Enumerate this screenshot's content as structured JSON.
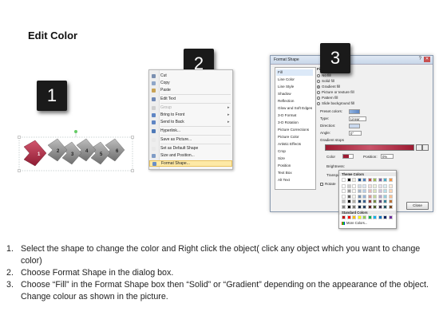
{
  "title": "Edit Color",
  "badges": [
    "1",
    "2",
    "3"
  ],
  "shape_labels": [
    "1",
    "2",
    "3",
    "4",
    "5",
    "6"
  ],
  "colors": {
    "highlight": "#b02a45",
    "shape_gray": "#8c8c8c",
    "menu_highlight": "#fde9a6",
    "gradient_red": "#9e1b32"
  },
  "context_menu": {
    "items": [
      {
        "label": "Cut",
        "icon": "scissors-icon"
      },
      {
        "label": "Copy",
        "icon": "copy-icon"
      },
      {
        "label": "Paste",
        "icon": "paste-icon"
      },
      {
        "label": "Edit Text",
        "icon": "edit-text-icon"
      },
      {
        "label": "Group",
        "icon": "group-icon"
      },
      {
        "label": "Bring to Front",
        "icon": "bring-to-front-icon"
      },
      {
        "label": "Send to Back",
        "icon": "send-to-back-icon"
      },
      {
        "label": "Hyperlink...",
        "icon": "hyperlink-icon"
      },
      {
        "label": "Save as Picture...",
        "icon": "save-picture-icon"
      },
      {
        "label": "Set as Default Shape",
        "icon": "default-shape-icon"
      },
      {
        "label": "Size and Position...",
        "icon": "size-position-icon"
      },
      {
        "label": "Format Shape...",
        "icon": "format-shape-icon"
      }
    ]
  },
  "dialog": {
    "title": "Format Shape",
    "nav": [
      "Fill",
      "Line Color",
      "Line Style",
      "Shadow",
      "Reflection",
      "Glow and Soft Edges",
      "3-D Format",
      "3-D Rotation",
      "Picture Corrections",
      "Picture Color",
      "Artistic Effects",
      "Crop",
      "Size",
      "Position",
      "Text Box",
      "Alt Text"
    ],
    "section": "Fill",
    "options": [
      "No fill",
      "Solid fill",
      "Gradient fill",
      "Picture or texture fill",
      "Pattern fill",
      "Slide background fill"
    ],
    "fields": {
      "preset": "Preset colors:",
      "type": "Type:",
      "type_value": "Linear",
      "direction": "Direction:",
      "angle": "Angle:",
      "angle_value": "0°",
      "gradient_stops": "Gradient stops",
      "color": "Color",
      "position": "Position:",
      "position_value": "0%",
      "brightness": "Brightness:",
      "transparency": "Transparen",
      "rotate": "Rotate"
    },
    "close_label": "Close"
  },
  "palette": {
    "theme": "Theme Colors",
    "standard": "Standard Colors",
    "more": "More Colors..."
  },
  "steps": [
    {
      "num": "1.",
      "text": "Select the shape to change the color and Right click the object( click any object which you want to change color)"
    },
    {
      "num": "2.",
      "text": "Choose Format Shape in the dialog box."
    },
    {
      "num": "3.",
      "text": "Choose “Fill” in the Format Shape box then “Solid” or “Gradient” depending on the appearance of the object. Change colour as shown in the picture."
    }
  ]
}
